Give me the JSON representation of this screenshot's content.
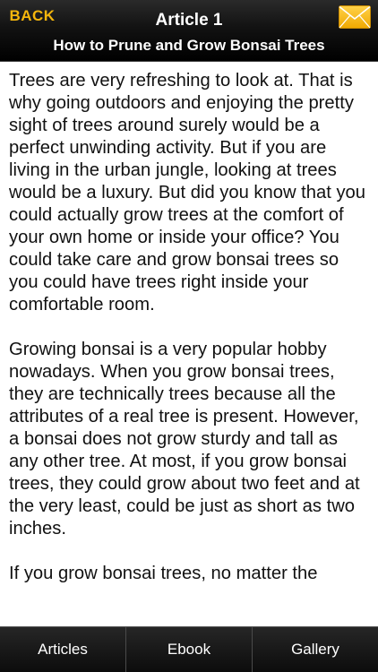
{
  "header": {
    "back_label": "BACK",
    "title": "Article 1",
    "subtitle": "How to Prune and Grow Bonsai Trees",
    "mail_icon": "envelope-icon",
    "accent_color": "#f5b60c"
  },
  "article": {
    "paragraphs": [
      "Trees are very refreshing to look at. That is why going outdoors and enjoying the pretty sight of trees around surely would be a perfect unwinding activity. But if you are living in the urban jungle, looking at trees would be a luxury. But did you know that you could actually grow trees at the comfort of your own home or inside your office? You could take care and grow bonsai trees so you could have trees right inside your comfortable room.",
      "Growing bonsai is a very popular hobby nowadays. When you grow bonsai trees, they are technically trees because all the attributes of a real tree is present. However, a bonsai does not grow sturdy and tall as any other tree. At most, if you grow bonsai trees, they could grow about two feet and at the very least, could be just as short as two inches.",
      "If you grow bonsai trees, no matter the"
    ]
  },
  "tabbar": {
    "tabs": [
      {
        "label": "Articles"
      },
      {
        "label": "Ebook"
      },
      {
        "label": "Gallery"
      }
    ]
  }
}
